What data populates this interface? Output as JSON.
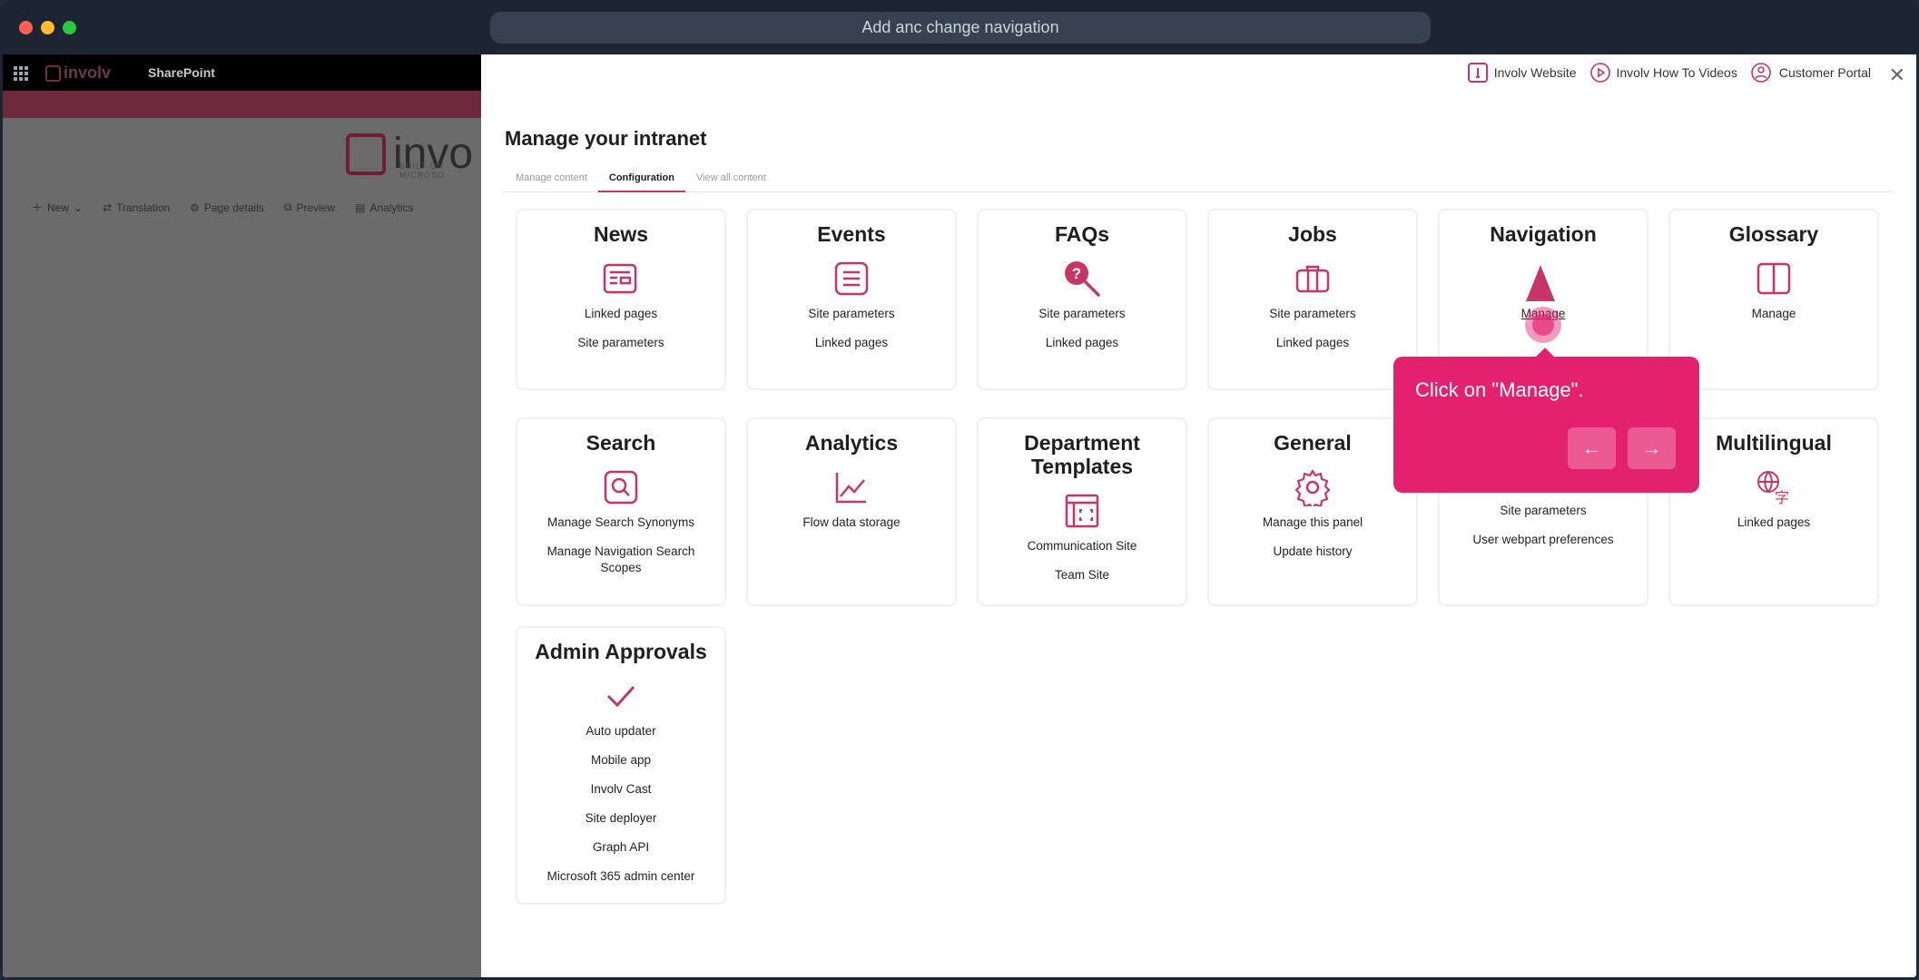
{
  "browser": {
    "url_title": "Add anc change navigation"
  },
  "sharepoint": {
    "logo_text": "involv",
    "brand": "SharePoint",
    "big_logo_text": "invo",
    "big_logo_sub": "BUILT ON MICROSO",
    "commands": [
      "New",
      "Translation",
      "Page details",
      "Preview",
      "Analytics"
    ]
  },
  "panel": {
    "toplinks": [
      "Involv Website",
      "Involv How To Videos",
      "Customer Portal"
    ],
    "title": "Manage your intranet",
    "tabs": [
      "Manage content",
      "Configuration",
      "View all content"
    ],
    "active_tab": "Configuration",
    "cards": [
      {
        "title": "News",
        "icon": "newspaper-icon",
        "links": [
          "Linked pages",
          "Site parameters"
        ]
      },
      {
        "title": "Events",
        "icon": "list-icon",
        "links": [
          "Site parameters",
          "Linked pages"
        ]
      },
      {
        "title": "FAQs",
        "icon": "question-search-icon",
        "links": [
          "Site parameters",
          "Linked pages"
        ]
      },
      {
        "title": "Jobs",
        "icon": "briefcase-icon",
        "links": [
          "Site parameters",
          "Linked pages"
        ]
      },
      {
        "title": "Navigation",
        "icon": "navigation-arrow-icon",
        "links": [
          "Manage"
        ]
      },
      {
        "title": "Glossary",
        "icon": "book-icon",
        "links": [
          "Manage"
        ]
      },
      {
        "title": "Search",
        "icon": "search-icon",
        "links": [
          "Manage Search Synonyms",
          "Manage Navigation Search Scopes"
        ]
      },
      {
        "title": "Analytics",
        "icon": "line-chart-icon",
        "links": [
          "Flow data storage"
        ]
      },
      {
        "title": "Department Templates",
        "icon": "template-icon",
        "links": [
          "Communication Site",
          "Team Site"
        ]
      },
      {
        "title": "General",
        "icon": "gear-icon",
        "links": [
          "Manage this panel",
          "Update history"
        ]
      },
      {
        "title": "",
        "icon": "home-icon",
        "links": [
          "Site parameters",
          "User webpart preferences"
        ]
      },
      {
        "title": "Multilingual",
        "icon": "translate-icon",
        "links": [
          "Linked pages"
        ]
      },
      {
        "title": "Admin Approvals",
        "icon": "checkmark-icon",
        "links": [
          "Auto updater",
          "Mobile app",
          "Involv Cast",
          "Site deployer",
          "Graph API",
          "Microsoft 365 admin center"
        ]
      }
    ]
  },
  "tooltip": {
    "text": "Click on \"Manage\"."
  },
  "colors": {
    "accent": "#c73566",
    "tooltip": "#e4216f"
  }
}
